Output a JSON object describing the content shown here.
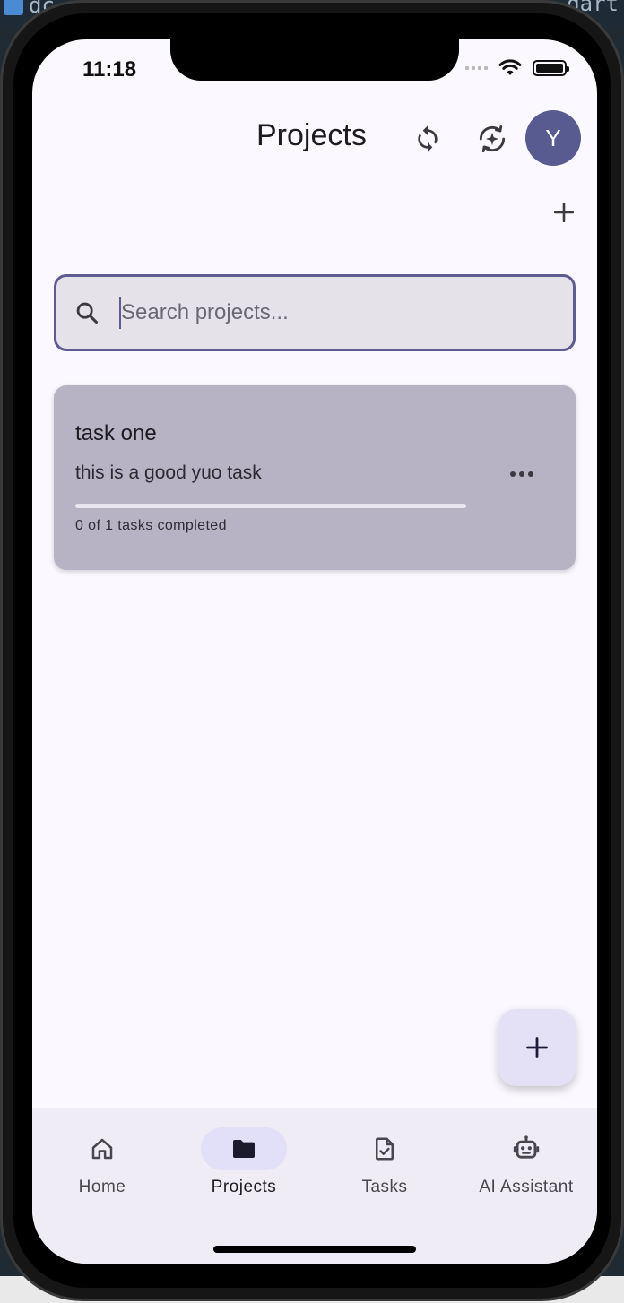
{
  "background": {
    "ide_left_fragment": "dc",
    "ide_right_fragment": "dart"
  },
  "status_bar": {
    "time": "11:18"
  },
  "app_bar": {
    "title": "Projects",
    "avatar_initial": "Y",
    "icons": [
      "sync-icon",
      "ai-sparkle-icon",
      "plus-icon"
    ]
  },
  "search": {
    "placeholder": "Search projects...",
    "value": ""
  },
  "projects": [
    {
      "title": "task one",
      "description": "this is a good yuo task",
      "progress_text": "0 of 1 tasks completed",
      "completed": 0,
      "total": 1,
      "progress_fraction": 0.0
    }
  ],
  "bottom_nav": {
    "items": [
      {
        "label": "Home",
        "icon": "home-icon",
        "active": false
      },
      {
        "label": "Projects",
        "icon": "folder-icon",
        "active": true
      },
      {
        "label": "Tasks",
        "icon": "task-document-icon",
        "active": false
      },
      {
        "label": "AI Assistant",
        "icon": "robot-icon",
        "active": false
      }
    ]
  },
  "colors": {
    "primary": "#5e5c8e",
    "background": "#fcf8ff",
    "card": "#b7b3c5",
    "nav_background": "#f0ecf5",
    "nav_active_pill": "#e2e0f8",
    "fab": "#e4e1f7"
  }
}
